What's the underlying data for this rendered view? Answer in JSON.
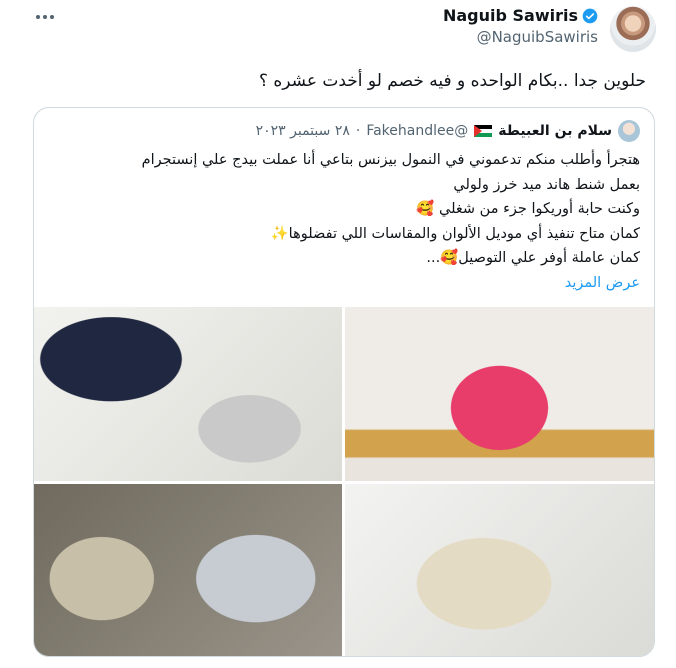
{
  "tweet": {
    "author_name": "Naguib Sawiris",
    "author_handle": "@NaguibSawiris",
    "text": "حلوين جدا ..بكام الواحده و فيه خصم لو أخدت عشره ؟"
  },
  "quote": {
    "author_name": "سلام بن العبيطة",
    "author_handle": "@Fakehandlee",
    "separator": "·",
    "date": "٢٨ سبتمبر ٢٠٢٣",
    "lines": [
      "هتجرأ وأطلب منكم تدعموني في النمول بيزنس بتاعي أنا عملت بيدج علي إنستجرام",
      "بعمل شنط هاند ميد خرز ولولي",
      "وكنت حابة أوريكوا جزء من شغلي 🥰",
      "كمان متاح تنفيذ أي موديل الألوان والمقاسات اللي تفضلوها✨",
      "كمان عاملة أوفر علي التوصيل🥰..."
    ],
    "show_more": "عرض المزيد"
  },
  "icons": {
    "more": "more-options-icon",
    "verified": "verified-badge-icon",
    "flag": "palestine-flag-icon"
  },
  "colors": {
    "accent": "#1d9bf0",
    "secondary_text": "#536471",
    "border": "#cfd9de"
  }
}
